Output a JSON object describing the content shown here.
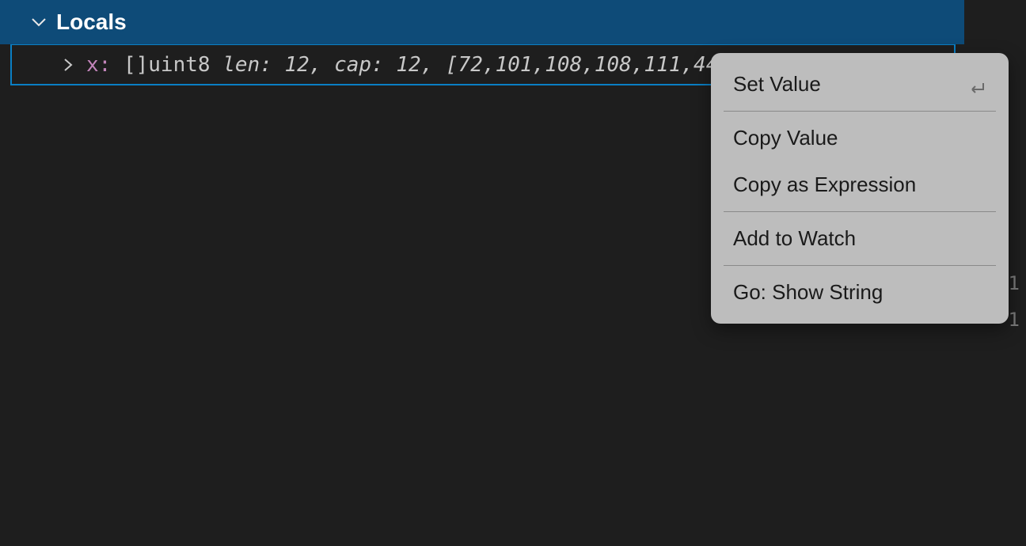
{
  "section": {
    "title": "Locals"
  },
  "variable": {
    "name": "x:",
    "type": "[]uint8 ",
    "details": "len: 12, cap: 12, ",
    "values": "[72,101,108,108,111,44"
  },
  "contextMenu": {
    "items": [
      {
        "label": "Set Value",
        "hasEnterIcon": true
      },
      {
        "label": "Copy Value"
      },
      {
        "label": "Copy as Expression"
      },
      {
        "label": "Add to Watch"
      },
      {
        "label": "Go: Show String"
      }
    ]
  },
  "gutter": {
    "lines": [
      "1",
      "1"
    ]
  }
}
